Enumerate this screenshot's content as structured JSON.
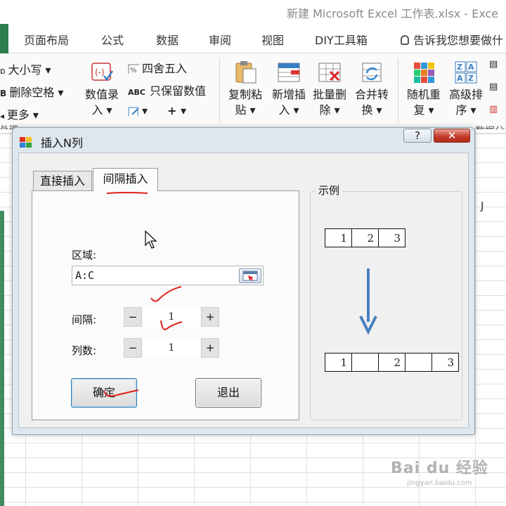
{
  "window": {
    "title": "新建 Microsoft Excel 工作表.xlsx - Exce"
  },
  "ribbon": {
    "tabs": [
      "页面布局",
      "公式",
      "数据",
      "审阅",
      "视图",
      "DIY工具箱"
    ],
    "tell_me": "告诉我您想要做什",
    "left_items": [
      "大小写 ▾",
      "删除空格 ▾",
      "更多 ▾"
    ],
    "small_items": [
      "四舍五入",
      "只保留数值",
      "▾",
      "+ ▾"
    ],
    "big_buttons": [
      {
        "line1": "数值录",
        "line2": "入 ▾"
      },
      {
        "line1": "复制粘",
        "line2": "贴 ▾"
      },
      {
        "line1": "新增插",
        "line2": "入 ▾"
      },
      {
        "line1": "批量删",
        "line2": "除 ▾"
      },
      {
        "line1": "合并转",
        "line2": "换 ▾"
      },
      {
        "line1": "随机重",
        "line2": "复 ▾"
      },
      {
        "line1": "高级排",
        "line2": "序 ▾"
      }
    ],
    "group_fragments": {
      "left": "处理",
      "right": "数据分"
    }
  },
  "dialog": {
    "title": "插入N列",
    "help": "?",
    "close": "✕",
    "tabs": [
      {
        "label": "直接插入",
        "active": false
      },
      {
        "label": "间隔插入",
        "active": true
      }
    ],
    "range_label": "区域:",
    "range_value": "A:C",
    "interval_label": "间隔:",
    "interval_value": "1",
    "columns_label": "列数:",
    "columns_value": "1",
    "minus": "−",
    "plus": "+",
    "ok": "确定",
    "exit": "退出",
    "example_title": "示例",
    "example_before": [
      "1",
      "2",
      "3"
    ],
    "example_after": [
      "1",
      "",
      "2",
      "",
      "3"
    ]
  },
  "sheet": {
    "cell_fragment": "J"
  },
  "colors": {
    "accent_green": "#2e7d4f",
    "arrow_blue": "#4a7fc1",
    "annotation_red": "#e0201a"
  },
  "watermark": {
    "brand": "Bai du 经验",
    "url": "jingyan.baidu.com"
  }
}
